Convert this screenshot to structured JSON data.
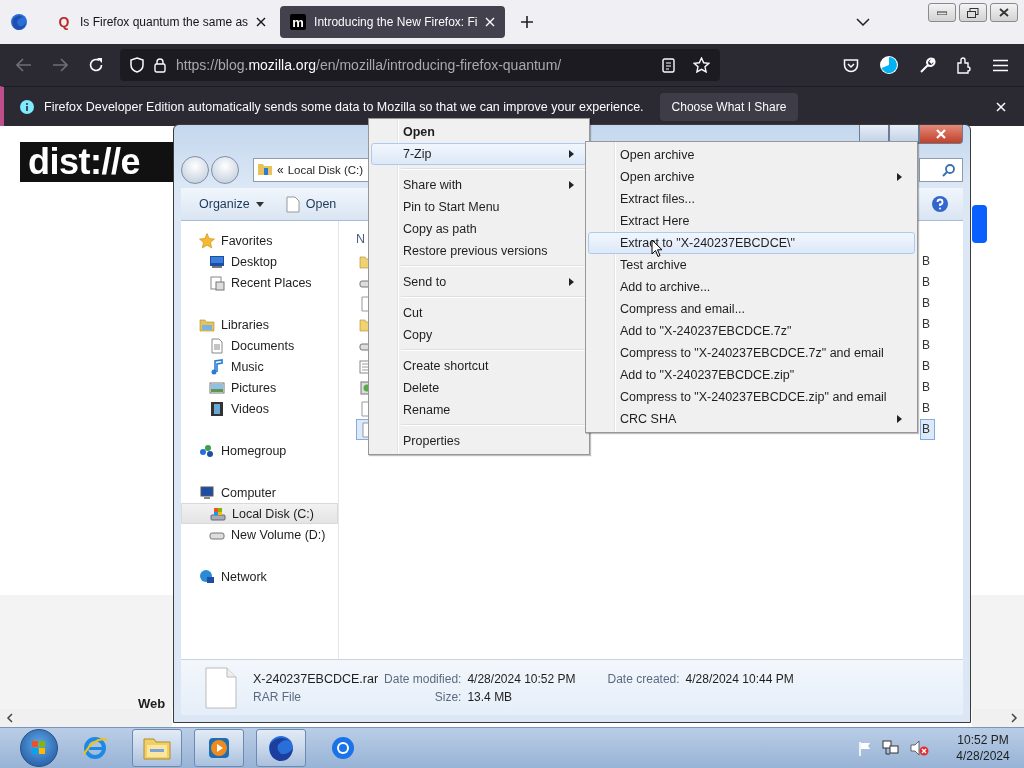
{
  "browser": {
    "tabs": [
      {
        "favicon": "Q",
        "title": "Is Firefox quantum the same as",
        "selected": false
      },
      {
        "favicon": "m",
        "title": "Introducing the New Firefox: Fi",
        "selected": true
      }
    ],
    "url": {
      "prefix": "https://blog.",
      "domain": "mozilla.org",
      "path": "/en/mozilla/introducing-firefox-quantum/"
    },
    "notification": {
      "message": "Firefox Developer Edition automatically sends some data to Mozilla so that we can improve your experience.",
      "button": "Choose What I Share"
    },
    "page": {
      "logo": "dist://e",
      "footer_text": "Web"
    }
  },
  "explorer": {
    "address_prefix": "«",
    "address": "Local Disk (C:)",
    "toolbar": [
      "Organize",
      "Open"
    ],
    "nav": [
      {
        "label": "Favorites",
        "kind": "star",
        "selected": false,
        "children": [
          {
            "label": "Desktop",
            "kind": "desktop",
            "selected": false
          },
          {
            "label": "Recent Places",
            "kind": "recent",
            "selected": false
          }
        ]
      },
      {
        "label": "Libraries",
        "kind": "library",
        "selected": false,
        "children": [
          {
            "label": "Documents",
            "kind": "document",
            "selected": false
          },
          {
            "label": "Music",
            "kind": "music",
            "selected": false
          },
          {
            "label": "Pictures",
            "kind": "picture",
            "selected": false
          },
          {
            "label": "Videos",
            "kind": "video",
            "selected": false
          }
        ]
      },
      {
        "label": "Homegroup",
        "kind": "homegroup",
        "selected": false
      },
      {
        "label": "Computer",
        "kind": "computer",
        "selected": false,
        "children": [
          {
            "label": "Local Disk (C:)",
            "kind": "disk",
            "selected": true
          },
          {
            "label": "New Volume (D:)",
            "kind": "drive",
            "selected": false
          }
        ]
      },
      {
        "label": "Network",
        "kind": "network",
        "selected": false
      }
    ],
    "list": {
      "header": "N",
      "rows": [
        {
          "kind": "folder",
          "size": "B",
          "selected": false
        },
        {
          "kind": "drive",
          "size": "B",
          "selected": false
        },
        {
          "kind": "file",
          "size": "B",
          "selected": false
        },
        {
          "kind": "folder",
          "size": "B",
          "selected": false
        },
        {
          "kind": "drive",
          "size": "B",
          "selected": false
        },
        {
          "kind": "text",
          "size": "B",
          "selected": false
        },
        {
          "kind": "setup",
          "size": "B",
          "selected": false
        },
        {
          "kind": "file",
          "size": "B",
          "selected": false
        },
        {
          "kind": "file",
          "size": "B",
          "selected": true
        }
      ]
    },
    "details": {
      "name": "X-240237EBCDCE.rar",
      "type": "RAR File",
      "modified_label": "Date modified:",
      "modified": "4/28/2024 10:52 PM",
      "size_label": "Size:",
      "size": "13.4 MB",
      "created_label": "Date created:",
      "created": "4/28/2024 10:44 PM"
    }
  },
  "context_menu": [
    {
      "kind": "item",
      "label": "Open",
      "bold": true,
      "submenu": false,
      "selected": false
    },
    {
      "kind": "item",
      "label": "7-Zip",
      "bold": false,
      "submenu": true,
      "selected": true
    },
    {
      "kind": "separator"
    },
    {
      "kind": "item",
      "label": "Share with",
      "bold": false,
      "submenu": true,
      "selected": false
    },
    {
      "kind": "item",
      "label": "Pin to Start Menu",
      "bold": false,
      "submenu": false,
      "selected": false
    },
    {
      "kind": "item",
      "label": "Copy as path",
      "bold": false,
      "submenu": false,
      "selected": false
    },
    {
      "kind": "item",
      "label": "Restore previous versions",
      "bold": false,
      "submenu": false,
      "selected": false
    },
    {
      "kind": "separator"
    },
    {
      "kind": "item",
      "label": "Send to",
      "bold": false,
      "submenu": true,
      "selected": false
    },
    {
      "kind": "separator"
    },
    {
      "kind": "item",
      "label": "Cut",
      "bold": false,
      "submenu": false,
      "selected": false
    },
    {
      "kind": "item",
      "label": "Copy",
      "bold": false,
      "submenu": false,
      "selected": false
    },
    {
      "kind": "separator"
    },
    {
      "kind": "item",
      "label": "Create shortcut",
      "bold": false,
      "submenu": false,
      "selected": false
    },
    {
      "kind": "item",
      "label": "Delete",
      "bold": false,
      "submenu": false,
      "selected": false
    },
    {
      "kind": "item",
      "label": "Rename",
      "bold": false,
      "submenu": false,
      "selected": false
    },
    {
      "kind": "separator"
    },
    {
      "kind": "item",
      "label": "Properties",
      "bold": false,
      "submenu": false,
      "selected": false
    }
  ],
  "submenu": [
    {
      "label": "Open archive",
      "submenu": false,
      "selected": false
    },
    {
      "label": "Open archive",
      "submenu": true,
      "selected": false
    },
    {
      "label": "Extract files...",
      "submenu": false,
      "selected": false
    },
    {
      "label": "Extract Here",
      "submenu": false,
      "selected": false
    },
    {
      "label": "Extract to \"X-240237EBCDCE\\\"",
      "submenu": false,
      "selected": true
    },
    {
      "label": "Test archive",
      "submenu": false,
      "selected": false
    },
    {
      "label": "Add to archive...",
      "submenu": false,
      "selected": false
    },
    {
      "label": "Compress and email...",
      "submenu": false,
      "selected": false
    },
    {
      "label": "Add to \"X-240237EBCDCE.7z\"",
      "submenu": false,
      "selected": false
    },
    {
      "label": "Compress to \"X-240237EBCDCE.7z\" and email",
      "submenu": false,
      "selected": false
    },
    {
      "label": "Add to \"X-240237EBCDCE.zip\"",
      "submenu": false,
      "selected": false
    },
    {
      "label": "Compress to \"X-240237EBCDCE.zip\" and email",
      "submenu": false,
      "selected": false
    },
    {
      "label": "CRC SHA",
      "submenu": true,
      "selected": false
    }
  ],
  "taskbar": {
    "apps": [
      {
        "kind": "ie",
        "running": false
      },
      {
        "kind": "explorer",
        "running": true
      },
      {
        "kind": "media",
        "running": true
      },
      {
        "kind": "firefox",
        "running": true
      },
      {
        "kind": "chrome",
        "running": false
      }
    ],
    "clock": {
      "time": "10:52 PM",
      "date": "4/28/2024"
    }
  }
}
